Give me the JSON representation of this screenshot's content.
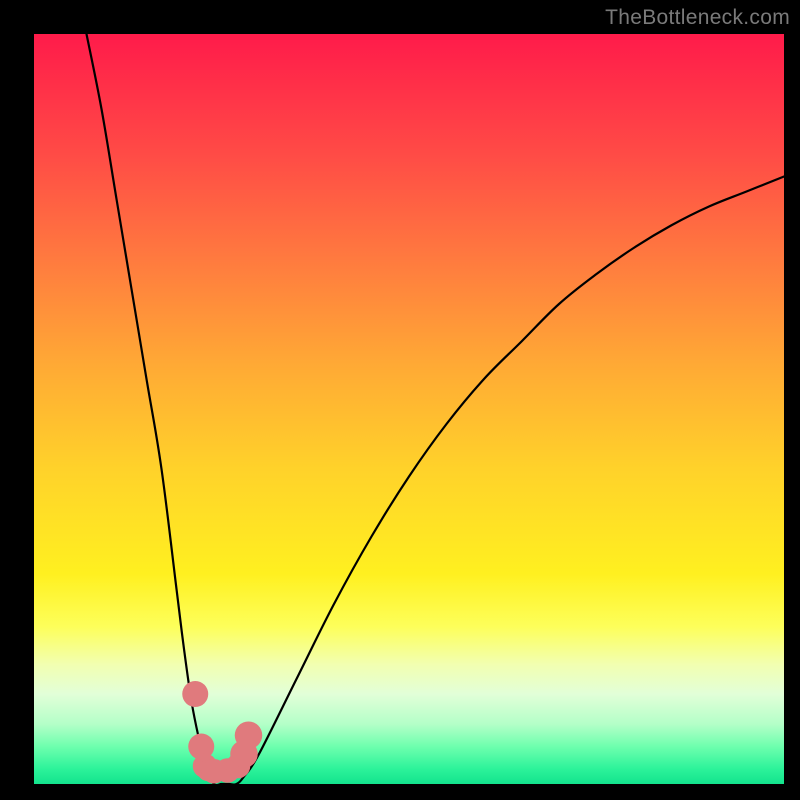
{
  "watermark": "TheBottleneck.com",
  "colors": {
    "frame": "#000000",
    "curve": "#000000",
    "dot": "#e07a7d",
    "gradient_top": "#ff1b4a",
    "gradient_bottom": "#13e38d"
  },
  "chart_data": {
    "type": "line",
    "title": "",
    "xlabel": "",
    "ylabel": "",
    "xlim": [
      0,
      100
    ],
    "ylim": [
      0,
      100
    ],
    "series": [
      {
        "name": "bottleneck-curve",
        "x": [
          7,
          9,
          11,
          13,
          15,
          17,
          19,
          20,
          21,
          22,
          23,
          24,
          25,
          26,
          27,
          28,
          30,
          35,
          40,
          45,
          50,
          55,
          60,
          65,
          70,
          75,
          80,
          85,
          90,
          95,
          100
        ],
        "y": [
          100,
          90,
          78,
          66,
          54,
          42,
          26,
          18,
          11,
          6,
          2,
          0,
          0,
          0,
          0,
          1,
          4,
          14,
          24,
          33,
          41,
          48,
          54,
          59,
          64,
          68,
          71.5,
          74.5,
          77,
          79,
          81
        ]
      }
    ],
    "markers": [
      {
        "x": 21.5,
        "y": 12,
        "r": 1.2
      },
      {
        "x": 22.3,
        "y": 5,
        "r": 1.2
      },
      {
        "x": 22.8,
        "y": 2.4,
        "r": 1.1
      },
      {
        "x": 23.2,
        "y": 1.8,
        "r": 0.9
      },
      {
        "x": 24.0,
        "y": 1.7,
        "r": 1.1
      },
      {
        "x": 25.8,
        "y": 1.8,
        "r": 1.1
      },
      {
        "x": 27.2,
        "y": 2.4,
        "r": 1.1
      },
      {
        "x": 28.0,
        "y": 4.0,
        "r": 1.3
      },
      {
        "x": 28.6,
        "y": 6.5,
        "r": 1.3
      }
    ]
  }
}
